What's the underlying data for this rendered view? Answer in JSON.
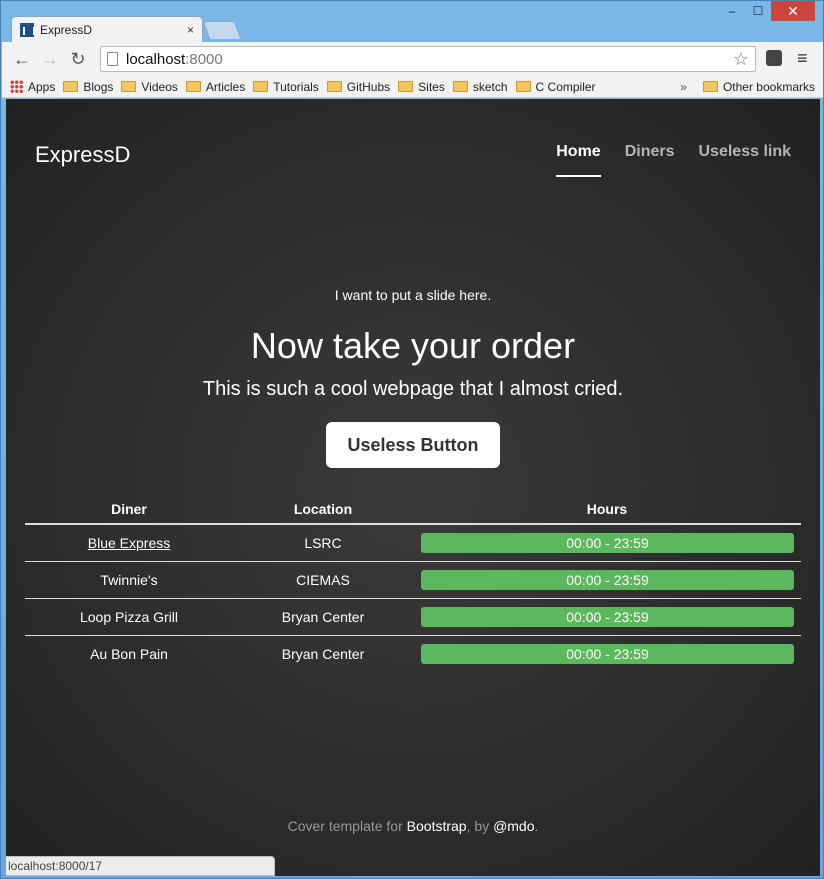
{
  "browser": {
    "tab_title": "ExpressD",
    "tab_close": "×",
    "url_host": "localhost",
    "url_port": ":8000",
    "status_url": "localhost:8000/17",
    "win_min": "–",
    "win_max": "☐",
    "win_close": "✕",
    "back": "←",
    "forward": "→",
    "reload": "↻",
    "star": "☆",
    "menu": "≡",
    "bookmarks": [
      "Apps",
      "Blogs",
      "Videos",
      "Articles",
      "Tutorials",
      "GitHubs",
      "Sites",
      "sketch",
      "C Compiler"
    ],
    "bookmarks_more": "»",
    "other_bookmarks": "Other bookmarks"
  },
  "site": {
    "brand": "ExpressD",
    "nav": [
      "Home",
      "Diners",
      "Useless link"
    ],
    "slide_text": "I want to put a slide here.",
    "heading": "Now take your order",
    "lead": "This is such a cool webpage that I almost cried.",
    "button": "Useless Button",
    "table": {
      "headers": [
        "Diner",
        "Location",
        "Hours"
      ],
      "rows": [
        {
          "diner": "Blue Express",
          "location": "LSRC",
          "hours": "00:00 - 23:59"
        },
        {
          "diner": "Twinnie's",
          "location": "CIEMAS",
          "hours": "00:00 - 23:59"
        },
        {
          "diner": "Loop Pizza Grill",
          "location": "Bryan Center",
          "hours": "00:00 - 23:59"
        },
        {
          "diner": "Au Bon Pain",
          "location": "Bryan Center",
          "hours": "00:00 - 23:59"
        }
      ]
    },
    "footer": {
      "pre": "Cover template for ",
      "link1": "Bootstrap",
      "mid": ", by ",
      "link2": "@mdo",
      "post": "."
    }
  },
  "colors": {
    "hours_bar": "#5cb85c",
    "page_bg": "#333333"
  }
}
